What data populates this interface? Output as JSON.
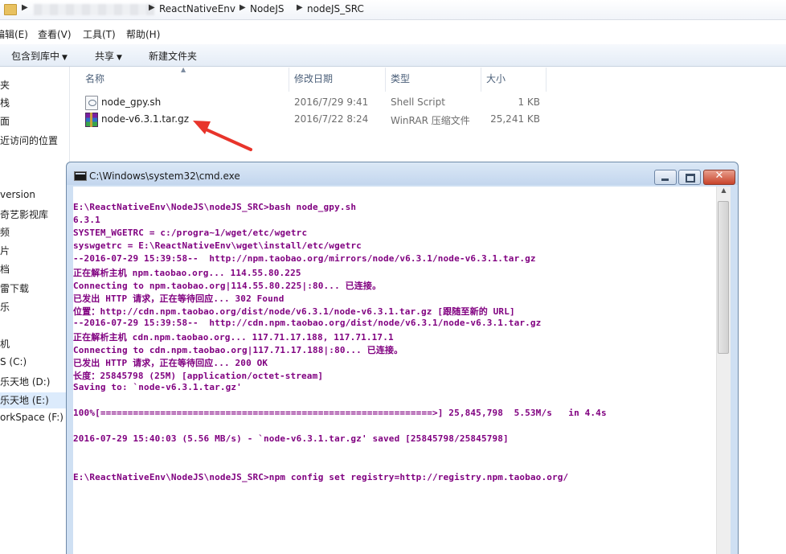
{
  "explorer": {
    "breadcrumbs": [
      "ReactNativeEnv",
      "NodeJS",
      "nodeJS_SRC"
    ],
    "menu": [
      "编辑(E)",
      "查看(V)",
      "工具(T)",
      "帮助(H)"
    ],
    "toolbar": {
      "include_library": "包含到库中",
      "share": "共享",
      "new_folder": "新建文件夹"
    },
    "nav_items": [
      "夹",
      "栈",
      "面",
      "近访问的位置",
      "version",
      "奇艺影视库",
      "频",
      "片",
      "档",
      "雷下载",
      "乐",
      "机",
      "S (C:)",
      "乐天地 (D:)",
      "乐天地 (E:)",
      "orkSpace (F:)"
    ],
    "columns": {
      "name": "名称",
      "date": "修改日期",
      "type": "类型",
      "size": "大小"
    },
    "files": [
      {
        "name": "node_gpy.sh",
        "date": "2016/7/29 9:41",
        "type": "Shell Script",
        "size": "1 KB",
        "icon": "shell-script-icon"
      },
      {
        "name": "node-v6.3.1.tar.gz",
        "date": "2016/7/22 8:24",
        "type": "WinRAR 压缩文件",
        "size": "25,241 KB",
        "icon": "winrar-archive-icon"
      }
    ],
    "annotation_color": "#e8342b"
  },
  "cmd": {
    "title": "C:\\Windows\\system32\\cmd.exe",
    "text_color": "#800080",
    "lines": [
      "E:\\ReactNativeEnv\\NodeJS\\nodeJS_SRC>bash node_gpy.sh",
      "6.3.1",
      "SYSTEM_WGETRC = c:/progra~1/wget/etc/wgetrc",
      "syswgetrc = E:\\ReactNativeEnv\\wget\\install/etc/wgetrc",
      "--2016-07-29 15:39:58--  http://npm.taobao.org/mirrors/node/v6.3.1/node-v6.3.1.tar.gz",
      "正在解析主机 npm.taobao.org... 114.55.80.225",
      "Connecting to npm.taobao.org|114.55.80.225|:80... 已连接。",
      "已发出 HTTP 请求，正在等待回应... 302 Found",
      "位置：http://cdn.npm.taobao.org/dist/node/v6.3.1/node-v6.3.1.tar.gz [跟随至新的 URL]",
      "--2016-07-29 15:39:58--  http://cdn.npm.taobao.org/dist/node/v6.3.1/node-v6.3.1.tar.gz",
      "正在解析主机 cdn.npm.taobao.org... 117.71.17.188, 117.71.17.1",
      "Connecting to cdn.npm.taobao.org|117.71.17.188|:80... 已连接。",
      "已发出 HTTP 请求，正在等待回应... 200 OK",
      "长度：25845798 (25M) [application/octet-stream]",
      "Saving to: `node-v6.3.1.tar.gz'",
      "",
      "100%[=============================================================>] 25,845,798  5.53M/s   in 4.4s",
      "",
      "2016-07-29 15:40:03 (5.56 MB/s) - `node-v6.3.1.tar.gz' saved [25845798/25845798]",
      "",
      "",
      "E:\\ReactNativeEnv\\NodeJS\\nodeJS_SRC>npm config set registry=http://registry.npm.taobao.org/"
    ]
  }
}
